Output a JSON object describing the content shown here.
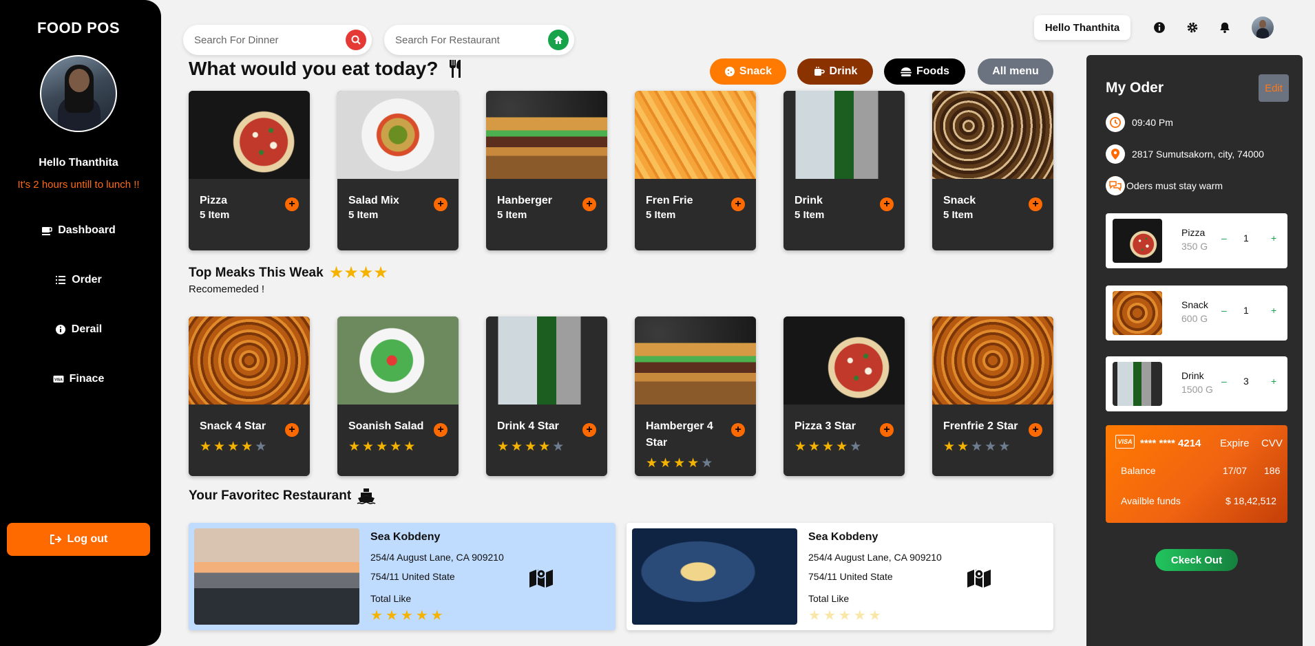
{
  "sidebar": {
    "brand": "FOOD POS",
    "greeting": "Hello Thanthita",
    "lunch_note": "It's 2 hours untill to lunch !!",
    "nav": [
      {
        "label": "Dashboard",
        "icon": "coffee-icon"
      },
      {
        "label": "Order",
        "icon": "list-icon"
      },
      {
        "label": "Derail",
        "icon": "info-icon"
      },
      {
        "label": "Finace",
        "icon": "card-icon"
      }
    ],
    "logout_label": "Log out"
  },
  "search": {
    "dinner_placeholder": "Search For Dinner",
    "restaurant_placeholder": "Search For Restaurant"
  },
  "header": {
    "greeting": "Hello Thanthita"
  },
  "main": {
    "title": "What would you eat today?",
    "filters": [
      {
        "label": "Snack",
        "color": "#ff7a00"
      },
      {
        "label": "Drink",
        "color": "#8a3300"
      },
      {
        "label": "Foods",
        "color": "#000000"
      },
      {
        "label": "All menu",
        "color": "#6b7280"
      }
    ],
    "categories": [
      {
        "name": "Pizza",
        "count": "5 Item"
      },
      {
        "name": "Salad Mix",
        "count": "5 Item"
      },
      {
        "name": "Hanberger",
        "count": "5 Item"
      },
      {
        "name": "Fren Frie",
        "count": "5 Item"
      },
      {
        "name": "Drink",
        "count": "5 Item"
      },
      {
        "name": "Snack",
        "count": "5 Item"
      }
    ],
    "top_title": "Top Meaks This Weak",
    "top_title_stars": 4,
    "top_sub": "Recomemeded !",
    "top_meals": [
      {
        "name": "Snack 4 Star",
        "rating": 4
      },
      {
        "name": "Soanish Salad",
        "rating": 5
      },
      {
        "name": "Drink 4 Star",
        "rating": 4
      },
      {
        "name": "Hamberger 4 Star",
        "rating": 4
      },
      {
        "name": "Pizza 3 Star",
        "rating": 4
      },
      {
        "name": "Frenfrie 2 Star",
        "rating": 2
      }
    ],
    "fav_title": "Your Favoritec Restaurant",
    "restaurants": [
      {
        "name": "Sea Kobdeny",
        "line1": "254/4 August Lane, CA 909210",
        "line2": "754/11 United State",
        "likes_label": "Total Like",
        "rating": 5,
        "bg": "#bfdbfe"
      },
      {
        "name": "Sea Kobdeny",
        "line1": "254/4 August Lane, CA 909210",
        "line2": "754/11 United State",
        "likes_label": "Total Like",
        "rating": 5,
        "bg": "#ffffff"
      }
    ]
  },
  "order": {
    "title": "My Oder",
    "edit_label": "Edit",
    "time": "09:40 Pm",
    "address": "2817 Sumutsakorn, city, 74000",
    "note": "Oders must stay warm",
    "items": [
      {
        "name": "Pizza",
        "weight": "350 G",
        "qty": "1"
      },
      {
        "name": "Snack",
        "weight": "600 G",
        "qty": "1"
      },
      {
        "name": "Drink",
        "weight": "1500 G",
        "qty": "3"
      }
    ],
    "card": {
      "brand": "VISA",
      "number": "**** **** 4214",
      "expire_label": "Expire",
      "cvv_label": "CVV",
      "balance_label": "Balance",
      "expire": "17/07",
      "cvv": "186",
      "funds_label": "Availble funds",
      "funds": "$ 18,42,512"
    },
    "checkout_label": "Ckeck Out"
  },
  "colors": {
    "accent": "#ff6a00",
    "star": "#f5b301",
    "star_off": "#6f7d90"
  }
}
